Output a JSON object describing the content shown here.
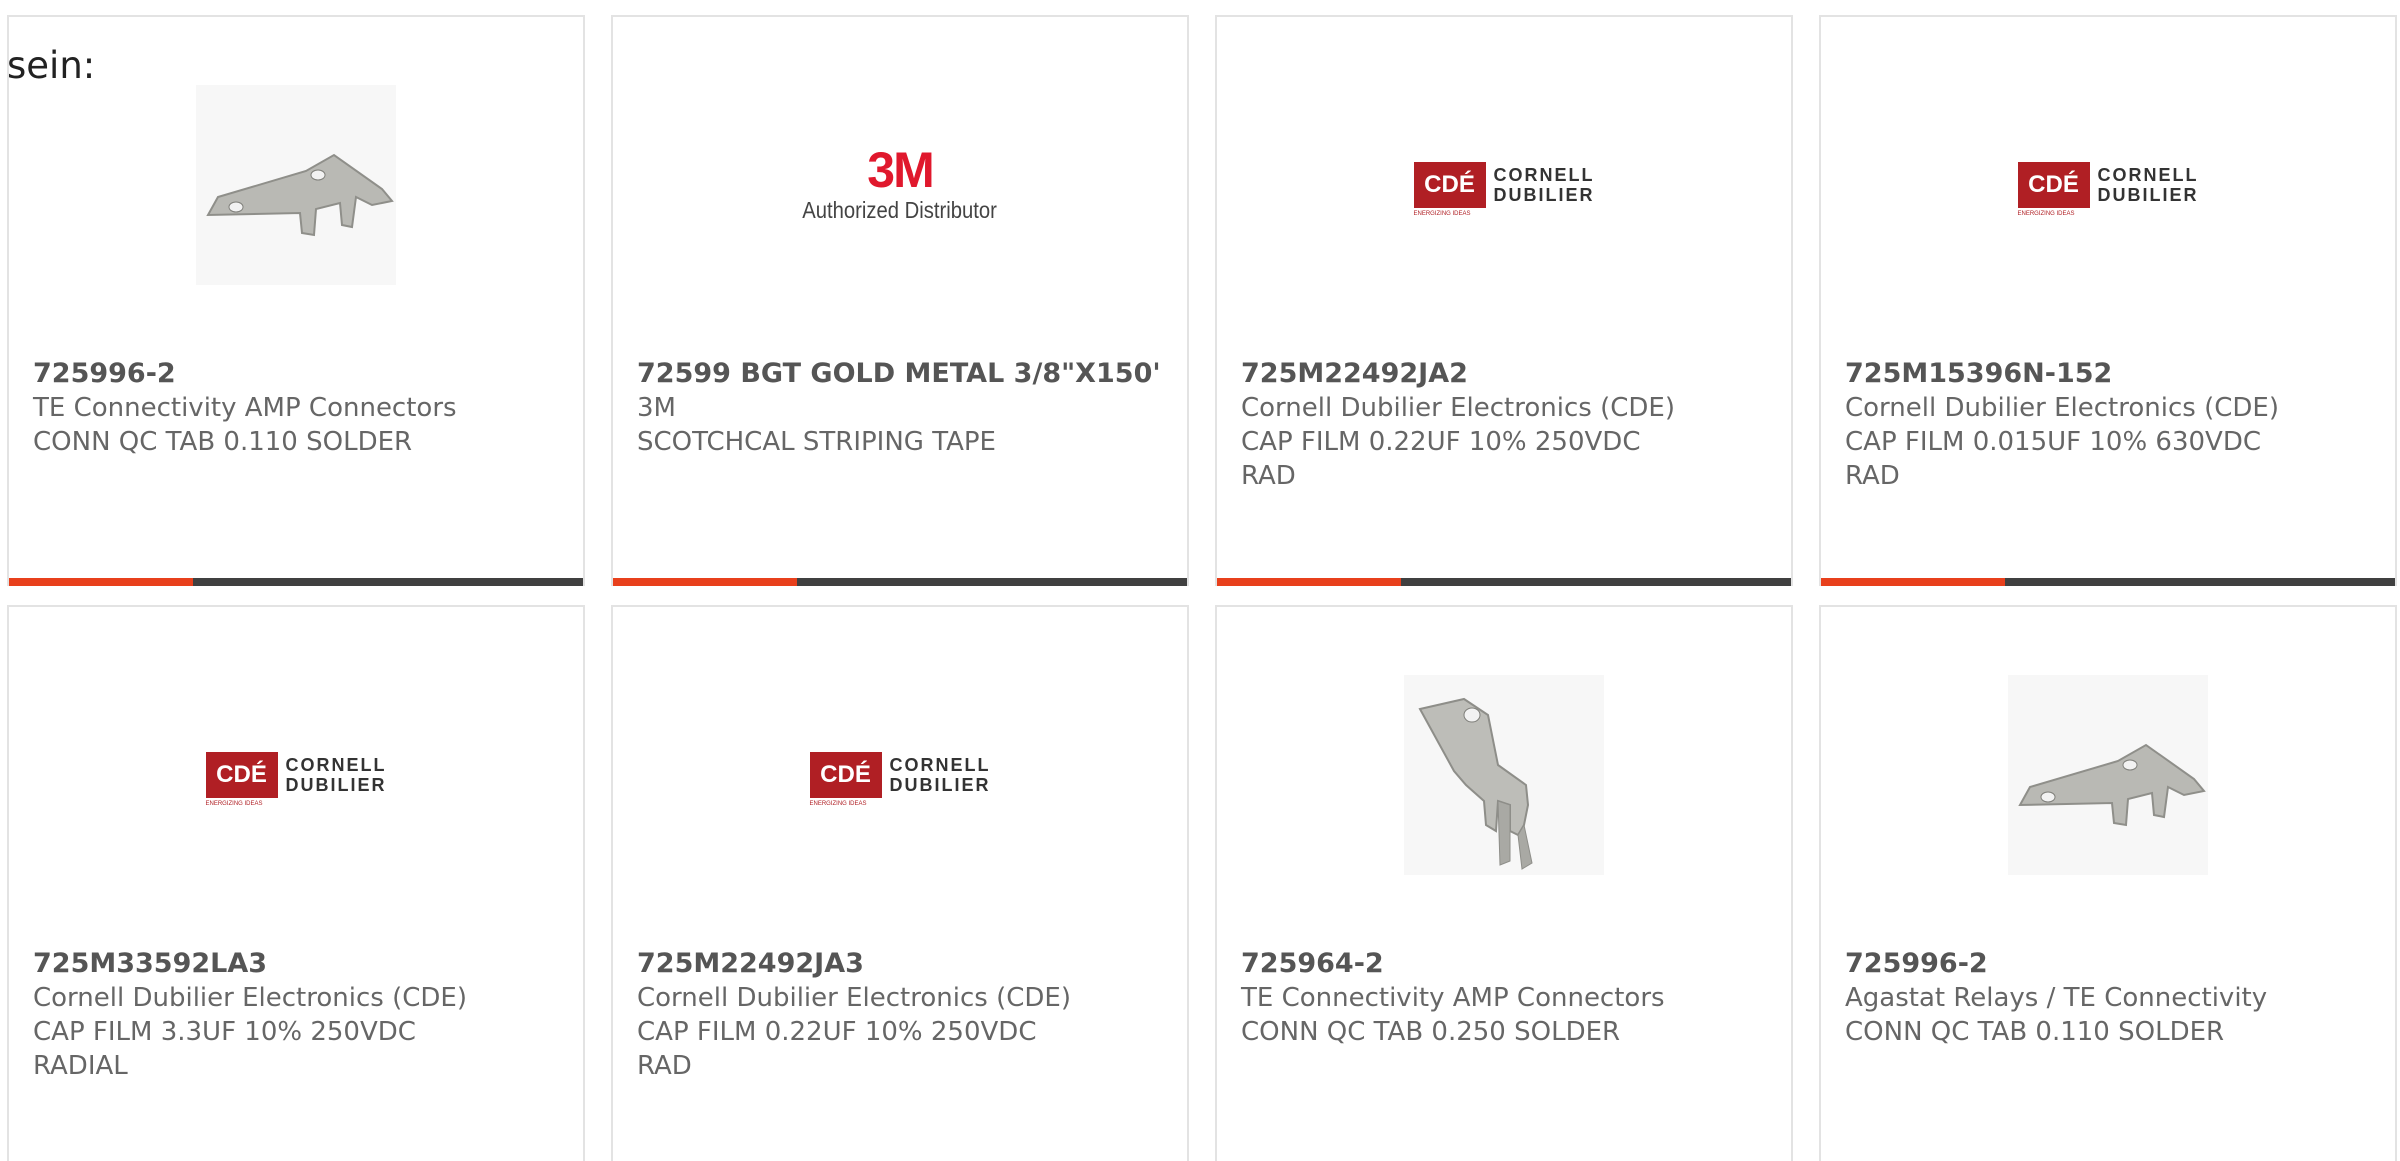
{
  "intro_text": "sein:",
  "colors": {
    "accent": "#e8401c",
    "bar": "#404040",
    "border": "#e3e3e3",
    "cde_red": "#b01f24",
    "logo_3m_red": "#e0182d"
  },
  "products": [
    {
      "part_number": "725996-2",
      "manufacturer": "TE Connectivity AMP Connectors",
      "description": "CONN QC TAB 0.110 SOLDER",
      "image": "qc-tab-right-angle-image"
    },
    {
      "part_number": "72599 BGT GOLD METAL 3/8\"X150'",
      "manufacturer": "3M",
      "description": "SCOTCHCAL STRIPING TAPE",
      "image": "3m-logo",
      "logo": {
        "mark": "3M",
        "sub": "Authorized Distributor"
      }
    },
    {
      "part_number": "725M22492JA2",
      "manufacturer": "Cornell Dubilier Electronics (CDE)",
      "description": "CAP FILM 0.22UF 10% 250VDC\nRAD",
      "image": "cde-logo"
    },
    {
      "part_number": "725M15396N-152",
      "manufacturer": "Cornell Dubilier Electronics (CDE)",
      "description": "CAP FILM 0.015UF 10% 630VDC\nRAD",
      "image": "cde-logo"
    },
    {
      "part_number": "725M33592LA3",
      "manufacturer": "Cornell Dubilier Electronics (CDE)",
      "description": "CAP FILM 3.3UF 10% 250VDC\nRADIAL",
      "image": "cde-logo"
    },
    {
      "part_number": "725M22492JA3",
      "manufacturer": "Cornell Dubilier Electronics (CDE)",
      "description": "CAP FILM 0.22UF 10% 250VDC\nRAD",
      "image": "cde-logo"
    },
    {
      "part_number": "725964-2",
      "manufacturer": "TE Connectivity AMP Connectors",
      "description": "CONN QC TAB 0.250 SOLDER",
      "image": "qc-tab-straight-image"
    },
    {
      "part_number": "725996-2",
      "manufacturer": "Agastat Relays / TE Connectivity",
      "description": "CONN QC TAB 0.110 SOLDER",
      "image": "qc-tab-right-angle-image"
    }
  ],
  "cde_logo": {
    "mark": "CDÉ",
    "word1": "CORNELL",
    "word2": "DUBILIER",
    "tagline": "ENERGIZING IDEAS"
  }
}
